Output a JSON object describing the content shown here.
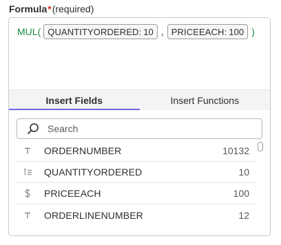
{
  "field": {
    "label": "Formula",
    "required_star": "*",
    "required_text": "(required)"
  },
  "formula": {
    "function_name": "MUL",
    "open_paren": "(",
    "separator": ",",
    "close_paren": ")",
    "args": [
      {
        "field": "QUANTITYORDERED:",
        "value": "10"
      },
      {
        "field": "PRICEEACH:",
        "value": "100"
      }
    ]
  },
  "tabs": [
    {
      "label": "Insert Fields",
      "active": true
    },
    {
      "label": "Insert Functions",
      "active": false
    }
  ],
  "search": {
    "placeholder": "Search"
  },
  "fields": [
    {
      "type_icon": "text-type-icon",
      "name": "ORDERNUMBER",
      "value": "10132"
    },
    {
      "type_icon": "number-type-icon",
      "name": "QUANTITYORDERED",
      "value": "10"
    },
    {
      "type_icon": "currency-type-icon",
      "name": "PRICEEACH",
      "value": "100"
    },
    {
      "type_icon": "text-type-icon",
      "name": "ORDERLINENUMBER",
      "value": "12"
    }
  ],
  "colors": {
    "accent": "#6b67e6",
    "function": "#1e8a3a",
    "required": "#d52a2a"
  }
}
